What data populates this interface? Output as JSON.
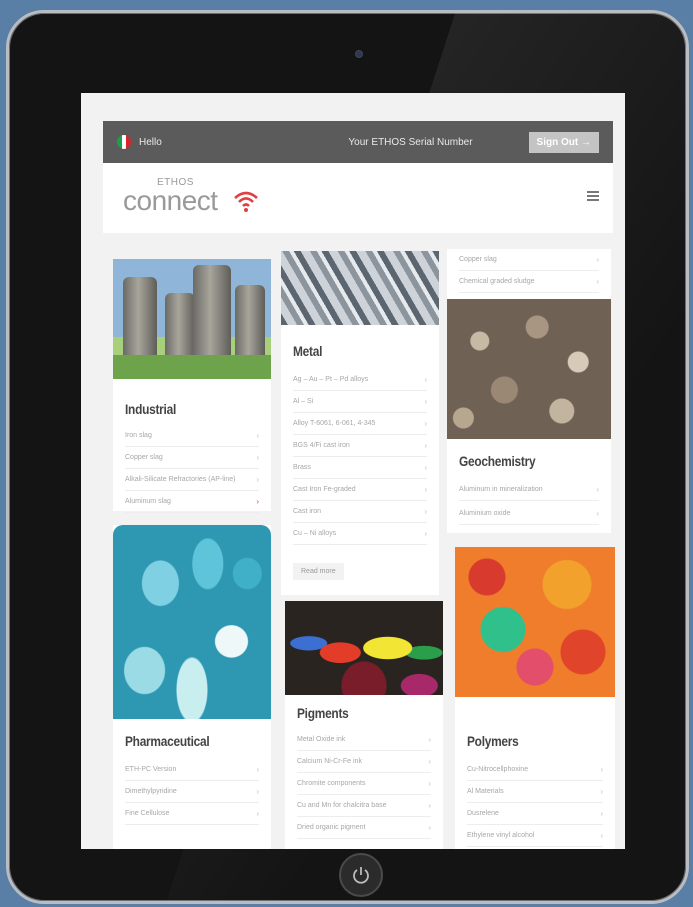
{
  "topbar": {
    "greeting": "Hello",
    "serial_label": "Your ETHOS Serial Number",
    "signout_label": "Sign Out →",
    "flag_colors": [
      "#1c9e4b",
      "#ffffff",
      "#d6262b"
    ]
  },
  "brand": {
    "ethos": "ETHOS",
    "connect": "connect",
    "accent_color": "#e04040"
  },
  "cards": {
    "industrial": {
      "title": "Industrial",
      "rows": [
        "Iron slag",
        "Copper slag",
        "Alkali-Silicate Refractories (AP-line)",
        "Aluminum slag"
      ]
    },
    "metal": {
      "title": "Metal",
      "rows": [
        "Ag – Au – Pt – Pd alloys",
        "Al – Si",
        "Alloy T-6061, 6-061, 4-345",
        "BGS 4/Fi cast iron",
        "Brass",
        "Cast Iron Fe-graded",
        "Cast iron",
        "Cu – Ni alloys"
      ],
      "read_more": "Read more"
    },
    "geo": {
      "top_rows": [
        "Copper slag",
        "Chemical graded sludge"
      ],
      "title": "Geochemistry",
      "rows": [
        "Aluminum in mineralization",
        "Aluminium oxide"
      ]
    },
    "pharma": {
      "title": "Pharmaceutical",
      "rows": [
        "ETH-PC Version",
        "Dimethylpyridine",
        "Fine Cellulose"
      ]
    },
    "pigments": {
      "title": "Pigments",
      "rows": [
        "Metal Oxide ink",
        "Calcium Ni-Cr-Fe ink",
        "Chromite components",
        "Cu and Mn for chalcitra base",
        "Dried organic pigment"
      ]
    },
    "polymers": {
      "title": "Polymers",
      "rows": [
        "Cu-Nitrocellphoxine",
        "Al Materials",
        "Dusrelene",
        "Ethylene vinyl alcohol"
      ]
    }
  }
}
